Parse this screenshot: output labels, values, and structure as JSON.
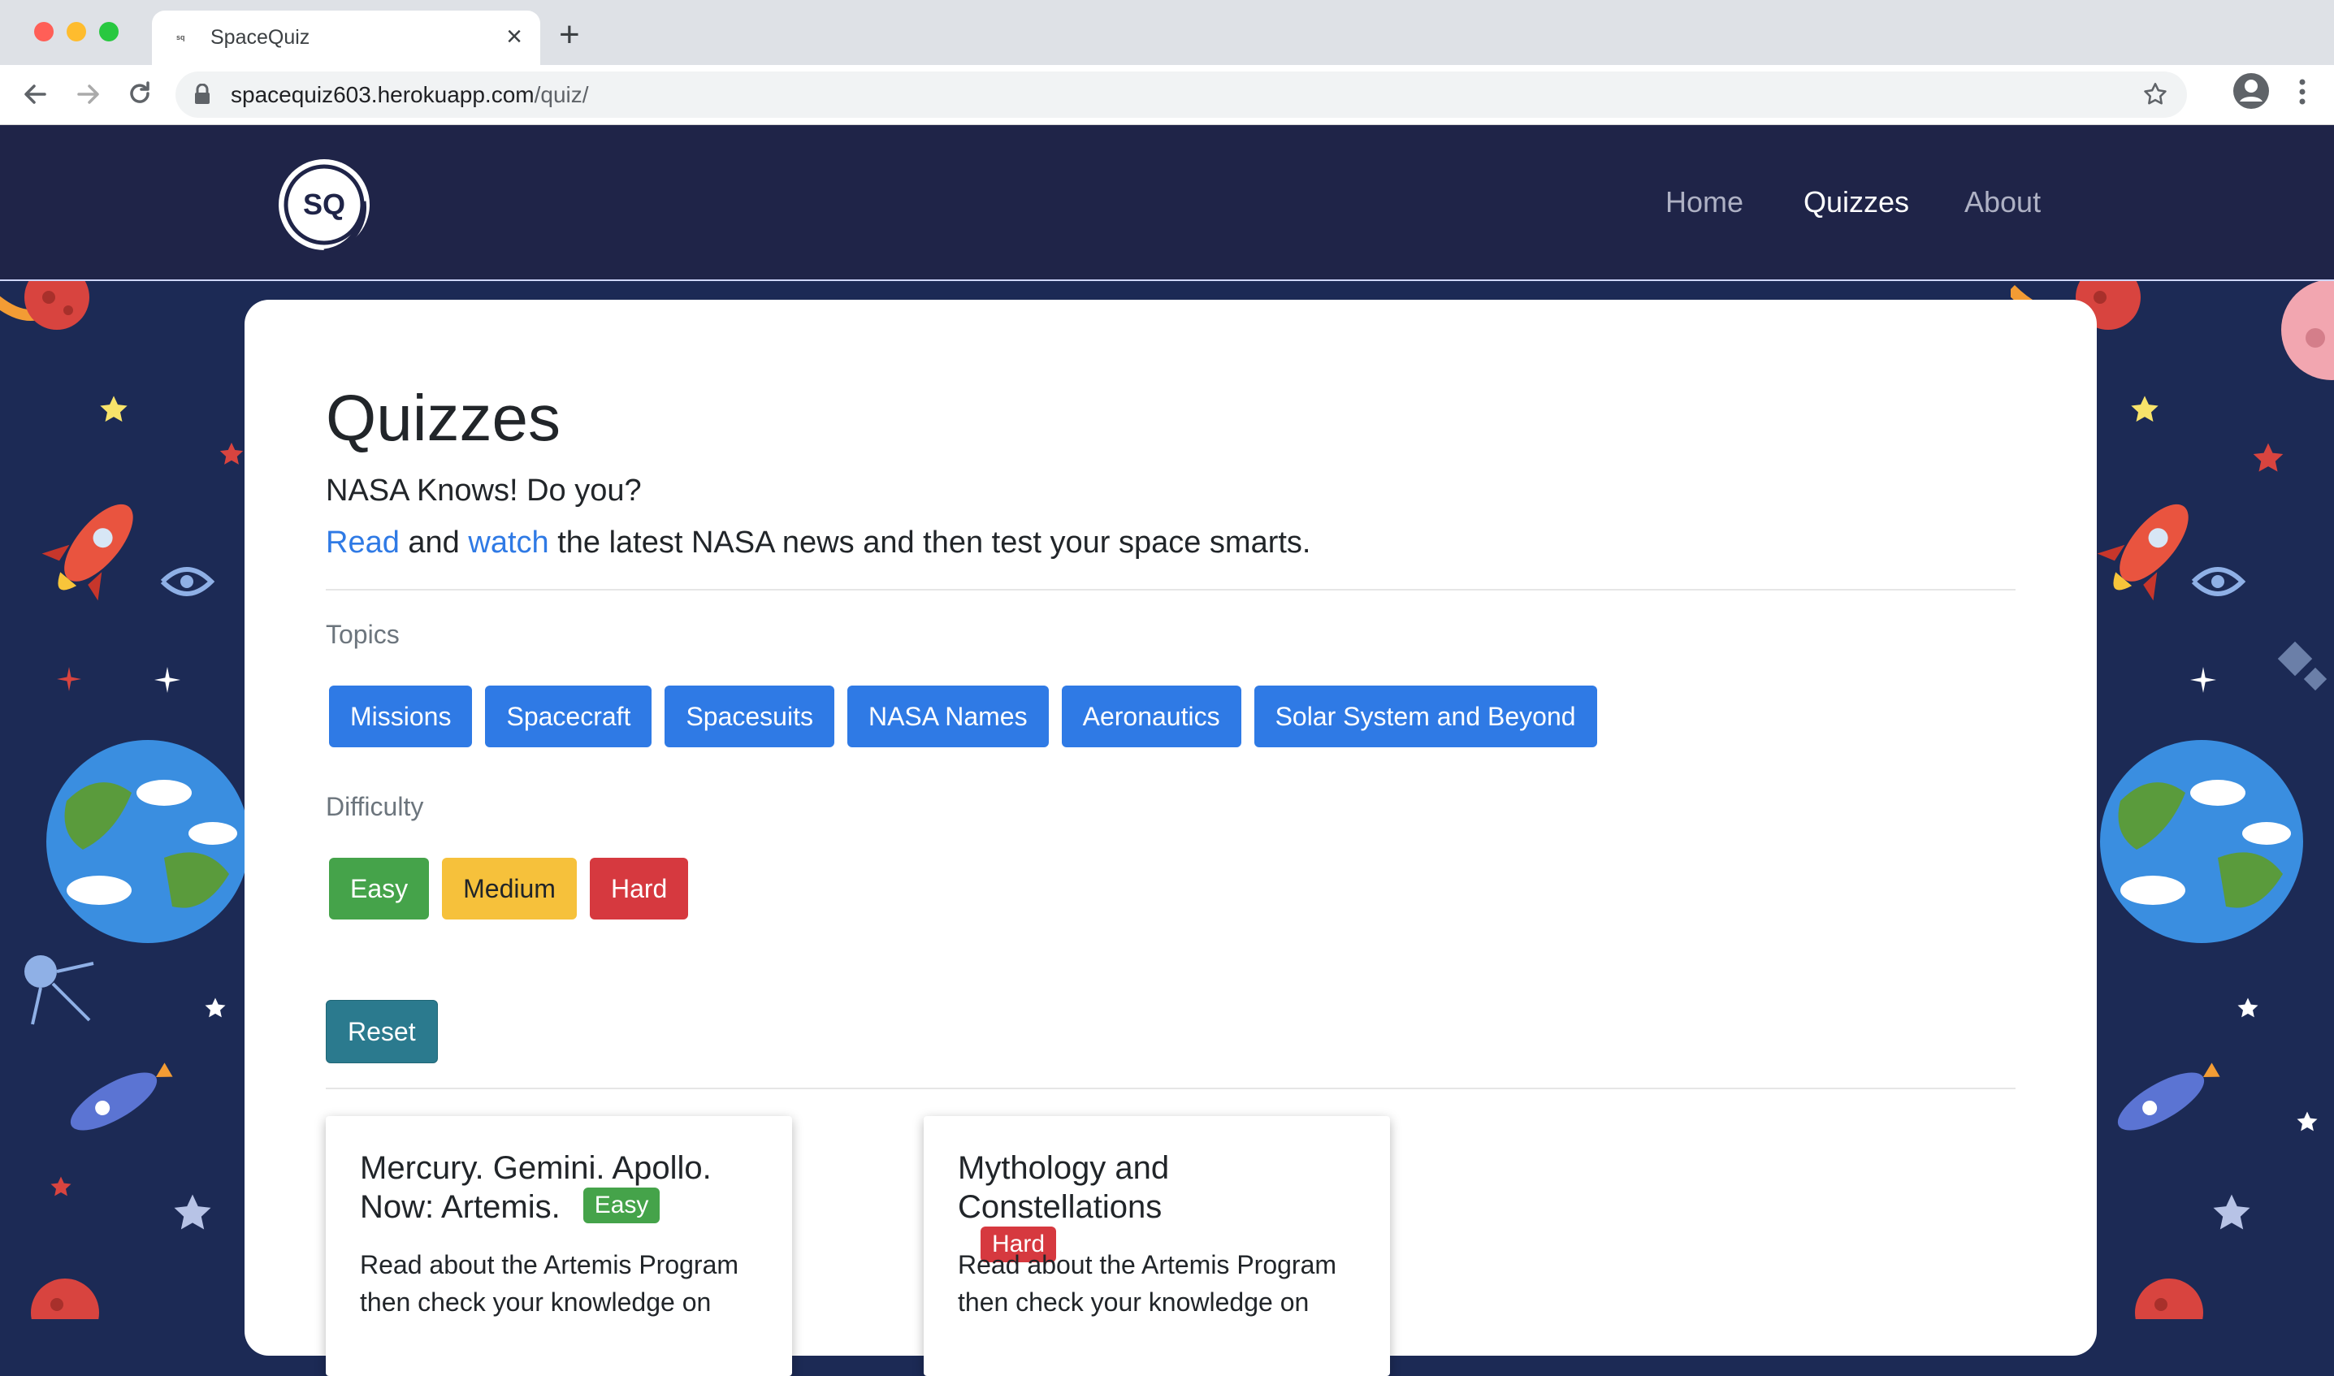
{
  "browser": {
    "tab_title": "SpaceQuiz",
    "tab_favicon": "sq",
    "url_host": "spacequiz603.herokuapp.com",
    "url_path": "/quiz/"
  },
  "navbar": {
    "logo_text": "SQ",
    "links": [
      {
        "label": "Home"
      },
      {
        "label": "Quizzes"
      },
      {
        "label": "About"
      }
    ]
  },
  "main": {
    "title": "Quizzes",
    "subtitle": "NASA Knows! Do you?",
    "intro": {
      "read_link": "Read",
      "and": " and ",
      "watch_link": "watch",
      "rest": " the latest NASA news and then test your space smarts."
    },
    "topics_label": "Topics",
    "topics": [
      "Missions",
      "Spacecraft",
      "Spacesuits",
      "NASA Names",
      "Aeronautics",
      "Solar System and Beyond"
    ],
    "difficulty_label": "Difficulty",
    "difficulties": [
      "Easy",
      "Medium",
      "Hard"
    ],
    "reset_label": "Reset",
    "quizzes": [
      {
        "title": "Mercury. Gemini. Apollo. Now: Artemis.",
        "difficulty": "Easy",
        "description": "Read about the Artemis Program then check your knowledge on"
      },
      {
        "title": "Mythology and Constellations",
        "difficulty": "Hard",
        "description": "Read about the Artemis Program then check your knowledge on"
      }
    ]
  },
  "colors": {
    "navbar": "#1f2448",
    "space": "#1c2a55",
    "primary": "#2f7ae5",
    "easy": "#45a34a",
    "medium": "#f6c13b",
    "hard": "#d6393f",
    "reset": "#2b7a8e"
  }
}
